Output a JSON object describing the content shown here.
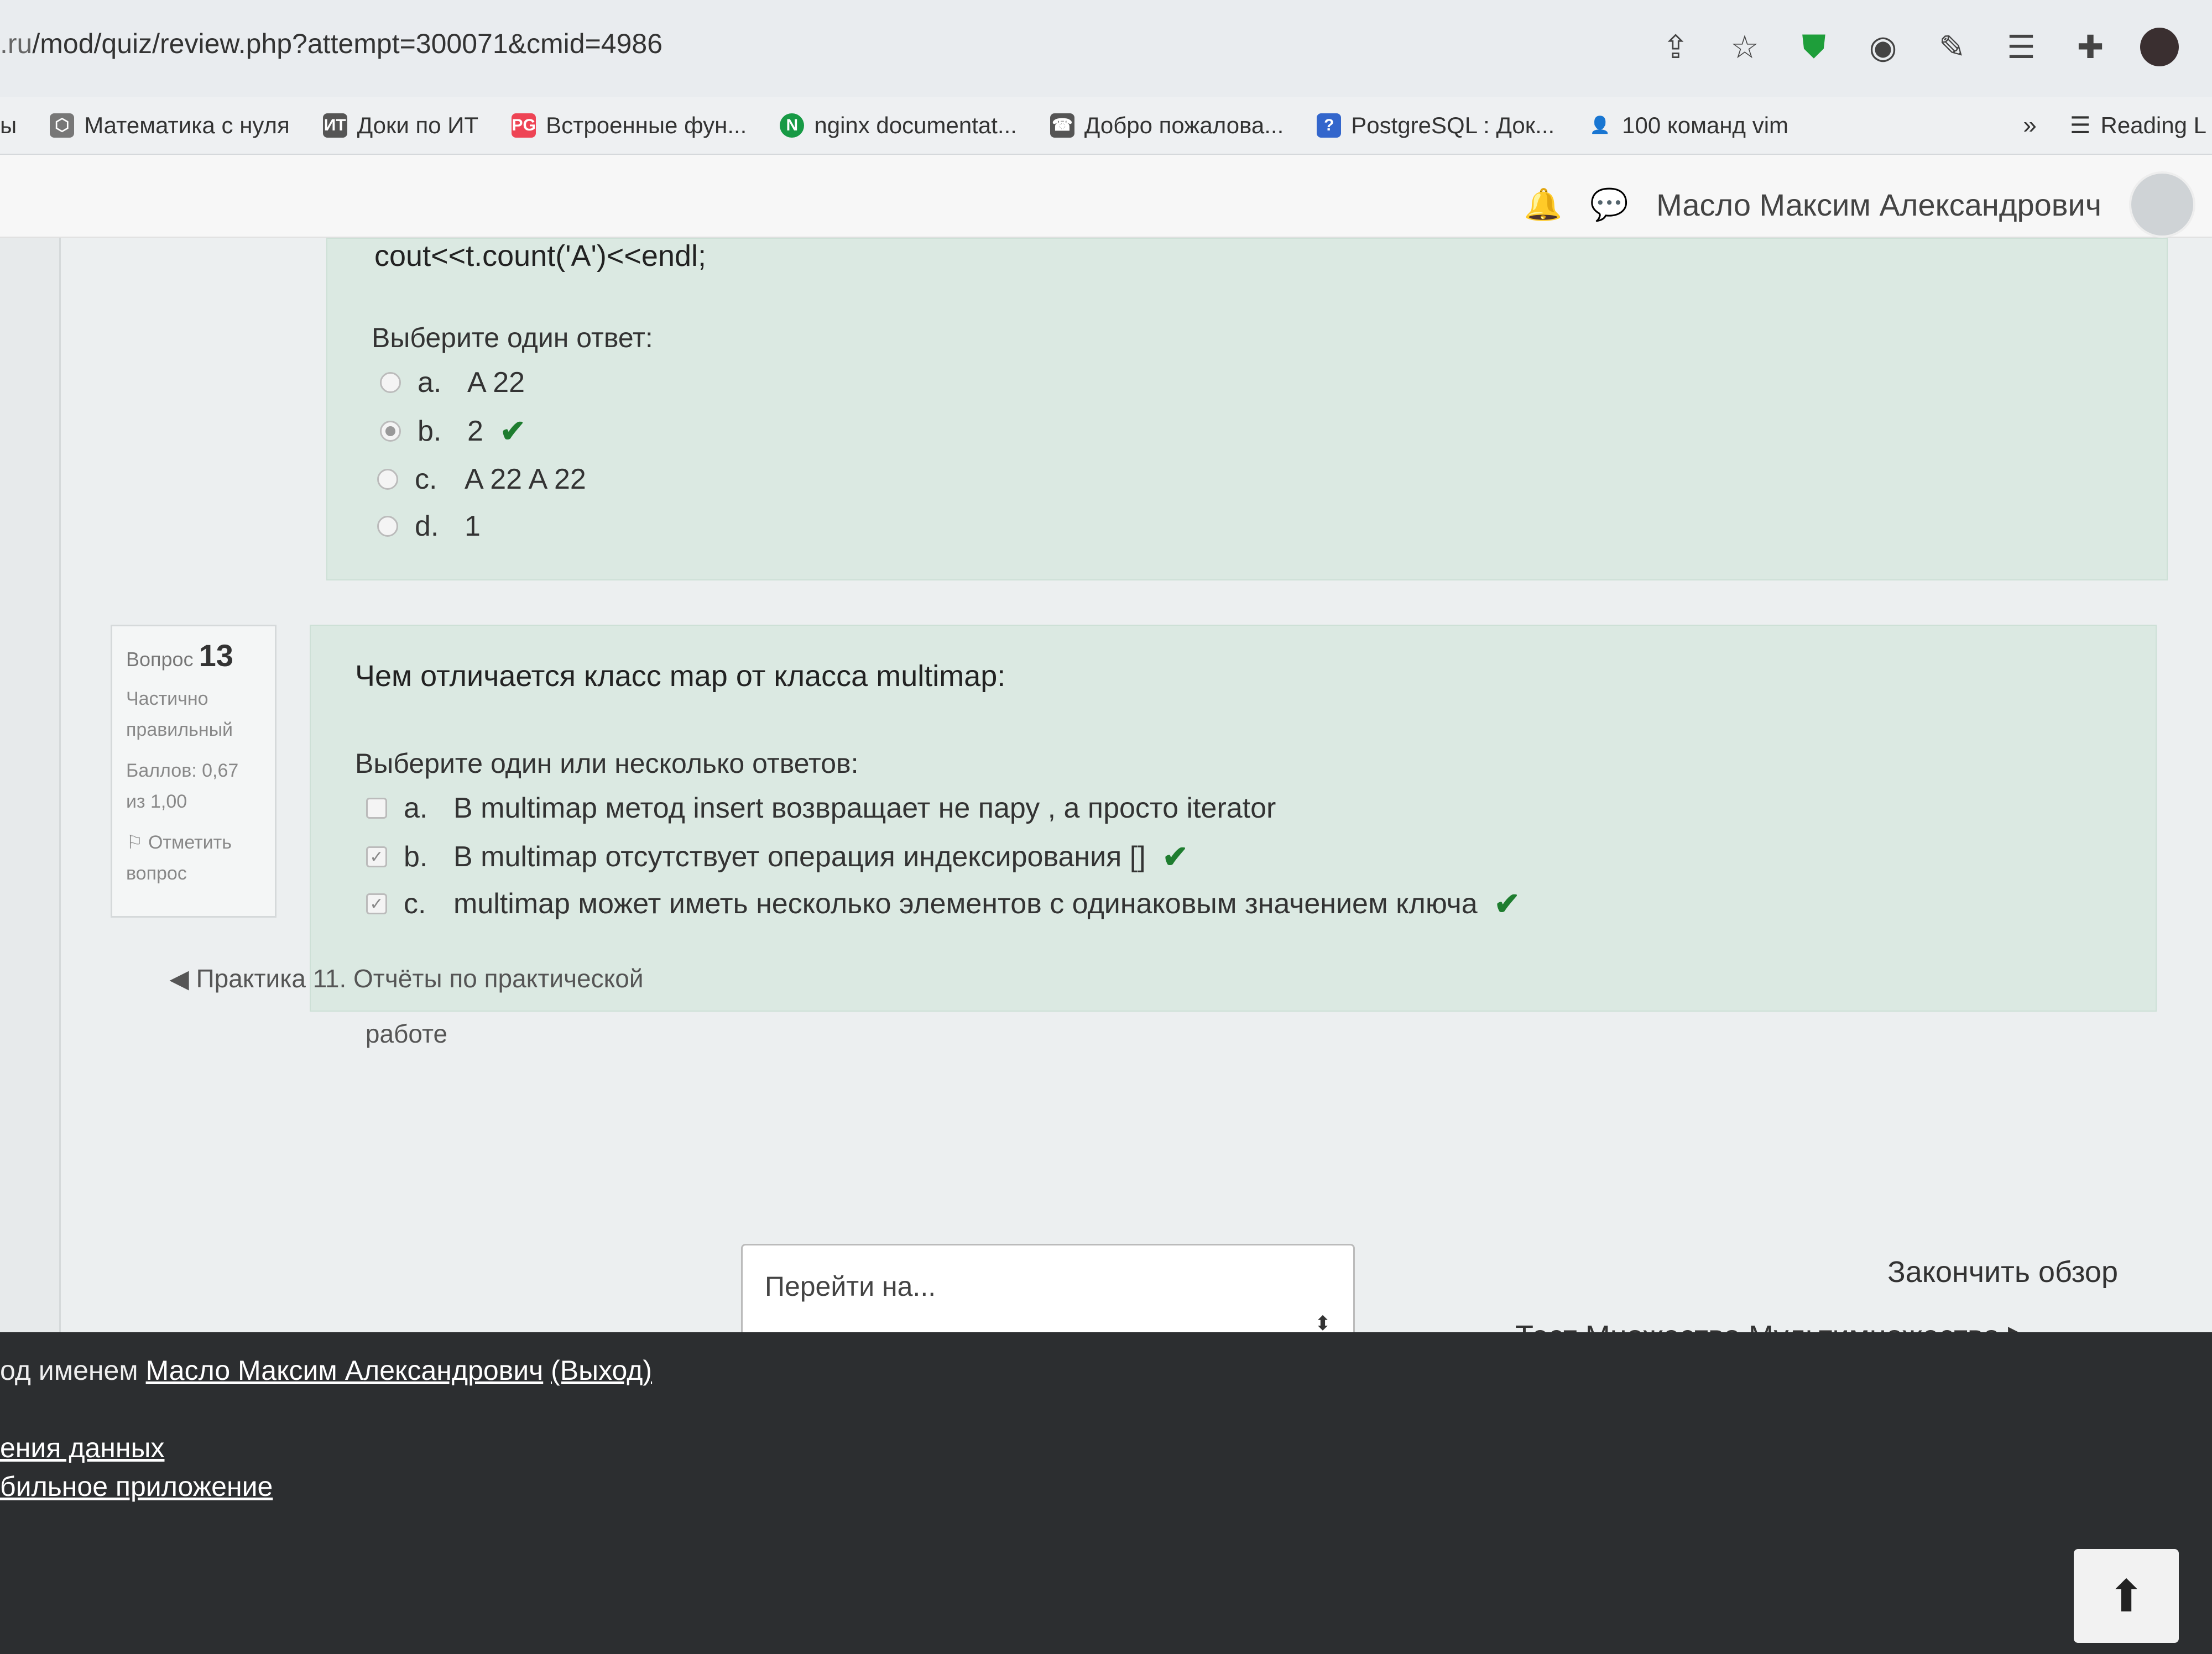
{
  "browser": {
    "url_host": ".ru",
    "url_path": "/mod/quiz/review.php?attempt=300071&cmid=4986",
    "bookmarks": [
      {
        "label": "ы",
        "icon": ""
      },
      {
        "label": "Математика с нуля",
        "icon": "⬡"
      },
      {
        "label": "Доки по ИТ",
        "icon": "ИТ"
      },
      {
        "label": "Встроенные фун...",
        "icon": "PG"
      },
      {
        "label": "nginx documentat...",
        "icon": "N"
      },
      {
        "label": "Добро пожалова...",
        "icon": "☎"
      },
      {
        "label": "PostgreSQL : Док...",
        "icon": "?"
      },
      {
        "label": "100 команд vim",
        "icon": "👤"
      }
    ],
    "more": "»",
    "reading": "Reading L"
  },
  "navbar": {
    "user_name": "Масло Максим Александрович"
  },
  "question12": {
    "code": "cout<<t.count('A')<<endl;",
    "prompt": "Выберите один ответ:",
    "answers": [
      {
        "letter": "a.",
        "text": "A 22",
        "selected": false,
        "correct": false
      },
      {
        "letter": "b.",
        "text": "2",
        "selected": true,
        "correct": true
      },
      {
        "letter": "c.",
        "text": "A 22 A 22",
        "selected": false,
        "correct": false
      },
      {
        "letter": "d.",
        "text": "1",
        "selected": false,
        "correct": false
      }
    ]
  },
  "question13": {
    "info": {
      "label": "Вопрос",
      "number": "13",
      "status": "Частично правильный",
      "score": "Баллов: 0,67 из 1,00",
      "flag": "Отметить вопрос"
    },
    "text": "Чем отличается класс map от класса multimap:",
    "prompt": "Выберите один или несколько ответов:",
    "answers": [
      {
        "letter": "a.",
        "text": "В multimap метод insert возвращает не пару , а просто iterator",
        "checked": false,
        "correct": false
      },
      {
        "letter": "b.",
        "text": "В multimap отсутствует операция индексирования []",
        "checked": true,
        "correct": true
      },
      {
        "letter": "c.",
        "text": "multimap может иметь несколько элементов с одинаковым значением ключа",
        "checked": true,
        "correct": true
      }
    ]
  },
  "navigation": {
    "prev": "◀ Практика 11. Отчёты по практической работе",
    "jump_placeholder": "Перейти на...",
    "finish": "Закончить обзор",
    "next": "Тест Множество.Мультимножество ▶"
  },
  "footer": {
    "logged_prefix": "од именем",
    "user": "Масло Максим Александрович",
    "logout": "(Выход)",
    "link1": "ения данных",
    "link2": "бильное приложение"
  }
}
